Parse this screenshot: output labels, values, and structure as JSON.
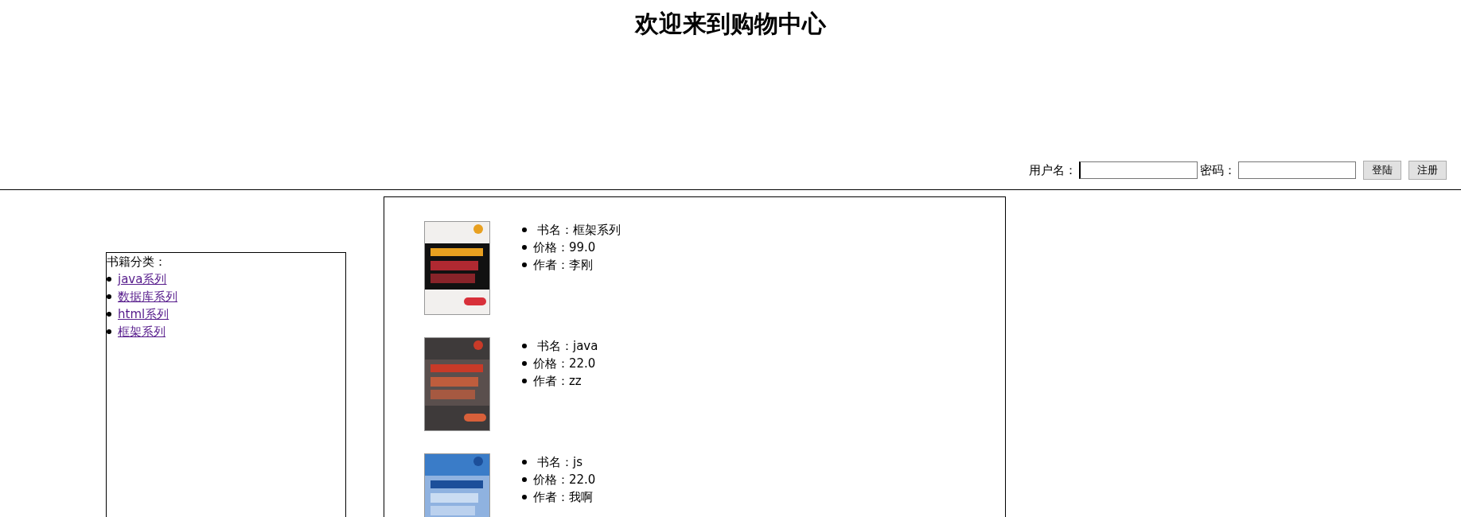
{
  "title": "欢迎来到购物中心",
  "login": {
    "username_label": "用户名：",
    "password_label": "密码：",
    "buttons": [
      "登陆",
      "注册"
    ]
  },
  "sidebar": {
    "heading": "书籍分类：",
    "items": [
      "java系列",
      "数据库系列",
      "html系列",
      "框架系列"
    ]
  },
  "books": [
    {
      "name": "书名：框架系列",
      "price": "价格：99.0",
      "author": "作者：李刚"
    },
    {
      "name": "书名：java",
      "price": "价格：22.0",
      "author": "作者：zz"
    },
    {
      "name": "书名：js",
      "price": "价格：22.0",
      "author": "作者：我啊"
    }
  ]
}
